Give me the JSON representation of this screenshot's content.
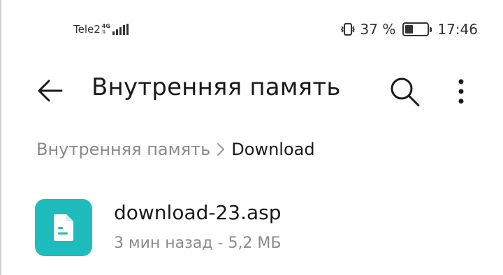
{
  "status_bar": {
    "carrier": "Tele2",
    "network_type": "4G",
    "battery_percent": "37 %",
    "battery_level": 0.37,
    "time": "17:46"
  },
  "app_bar": {
    "title": "Внутренняя память",
    "icons": {
      "back": "arrow-left-icon",
      "search": "search-icon",
      "more": "more-vertical-icon"
    }
  },
  "breadcrumb": {
    "root": "Внутренняя память",
    "current": "Download"
  },
  "files": [
    {
      "name": "download-23.asp",
      "meta": "3 мин назад - 5,2 МБ",
      "icon": "document-icon",
      "icon_color": "#1ebcbc"
    }
  ]
}
